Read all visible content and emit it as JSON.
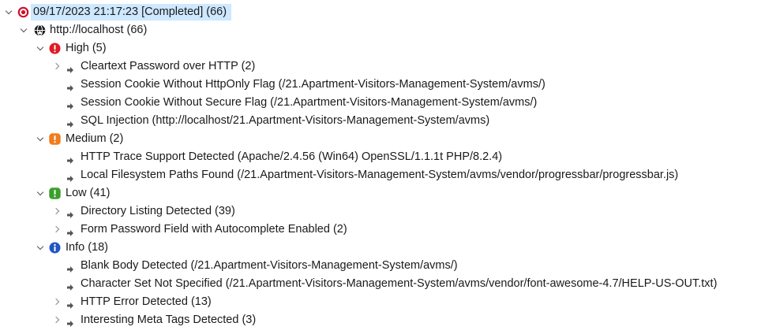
{
  "scan": {
    "root_label": "09/17/2023 21:17:23 [Completed]  (66)",
    "host_label": "http://localhost (66)",
    "groups": [
      {
        "label": "High (5)",
        "severity_color": "#e01b24",
        "items": [
          {
            "label": "Cleartext Password over HTTP (2)",
            "expandable": true
          },
          {
            "label": "Session Cookie Without HttpOnly Flag  (/21.Apartment-Visitors-Management-System/avms/)",
            "expandable": false
          },
          {
            "label": "Session Cookie Without Secure Flag  (/21.Apartment-Visitors-Management-System/avms/)",
            "expandable": false
          },
          {
            "label": "SQL Injection (http://localhost/21.Apartment-Visitors-Management-System/avms)",
            "expandable": false
          }
        ]
      },
      {
        "label": "Medium (2)",
        "severity_color": "#f07c1e",
        "items": [
          {
            "label": "HTTP Trace Support Detected (Apache/2.4.56 (Win64) OpenSSL/1.1.1t PHP/8.2.4)",
            "expandable": false
          },
          {
            "label": "Local Filesystem Paths Found (/21.Apartment-Visitors-Management-System/avms/vendor/progressbar/progressbar.js)",
            "expandable": false
          }
        ]
      },
      {
        "label": "Low (41)",
        "severity_color": "#3aa02a",
        "items": [
          {
            "label": "Directory Listing Detected (39)",
            "expandable": true
          },
          {
            "label": "Form Password Field with Autocomplete Enabled (2)",
            "expandable": true
          }
        ]
      },
      {
        "label": "Info (18)",
        "severity_color": "#1f56c4",
        "items": [
          {
            "label": "Blank Body Detected (/21.Apartment-Visitors-Management-System/avms/)",
            "expandable": false
          },
          {
            "label": "Character Set Not Specified  (/21.Apartment-Visitors-Management-System/avms/vendor/font-awesome-4.7/HELP-US-OUT.txt)",
            "expandable": false
          },
          {
            "label": "HTTP Error Detected (13)",
            "expandable": true
          },
          {
            "label": "Interesting Meta Tags Detected (3)",
            "expandable": true
          }
        ]
      }
    ]
  },
  "colors": {
    "selection_bg": "#cde8ff",
    "target_icon": "#d0102a",
    "host_icon": "#222222",
    "bullet_icon": "#555555"
  },
  "icons": {
    "root": "scan-target-icon",
    "host": "globe-host-icon",
    "high": "exclamation-high-icon",
    "medium": "exclamation-medium-icon",
    "low": "exclamation-low-icon",
    "info": "info-icon",
    "item": "arrow-bullet-icon"
  }
}
